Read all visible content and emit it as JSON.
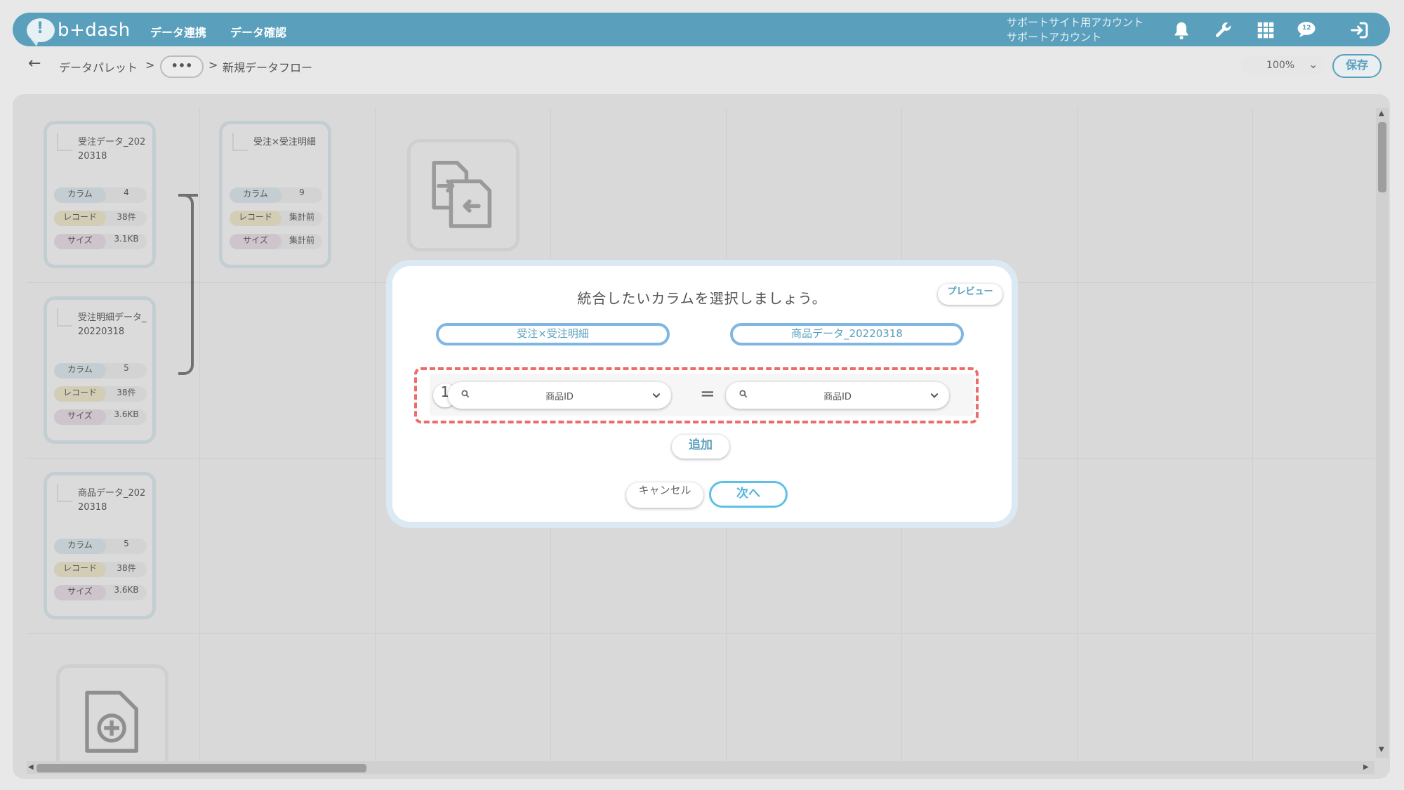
{
  "header": {
    "logo_text": "b+dash",
    "nav": [
      "データ連携",
      "データ確認"
    ],
    "account_line1": "サポートサイト用アカウント",
    "account_line2": "サポートアカウント",
    "icons": [
      "bell-icon",
      "wrench-icon",
      "apps-grid-icon",
      "chat-bubble-icon",
      "logout-icon"
    ],
    "chat_badge": "12",
    "color": "#5aa0bd"
  },
  "breadcrumb": {
    "root": "データパレット",
    "sep": ">",
    "more": "•••",
    "current": "新規データフロー"
  },
  "toolbar": {
    "zoom": "100%",
    "save_label": "保存"
  },
  "nodes": [
    {
      "title": "受注データ_20220318",
      "rows": [
        {
          "k": "カラム",
          "v": "4"
        },
        {
          "k": "レコード",
          "v": "38件"
        },
        {
          "k": "サイズ",
          "v": "3.1KB"
        }
      ]
    },
    {
      "title": "受注明細データ_20220318",
      "rows": [
        {
          "k": "カラム",
          "v": "5"
        },
        {
          "k": "レコード",
          "v": "38件"
        },
        {
          "k": "サイズ",
          "v": "3.6KB"
        }
      ]
    },
    {
      "title": "商品データ_20220318",
      "rows": [
        {
          "k": "カラム",
          "v": "5"
        },
        {
          "k": "レコード",
          "v": "38件"
        },
        {
          "k": "サイズ",
          "v": "3.6KB"
        }
      ]
    },
    {
      "title": "受注×受注明細",
      "rows": [
        {
          "k": "カラム",
          "v": "9"
        },
        {
          "k": "レコード",
          "v": "集計前"
        },
        {
          "k": "サイズ",
          "v": "集計前"
        }
      ]
    }
  ],
  "modal": {
    "title": "統合したいカラムを選択しましょう。",
    "preview_label": "プレビュー",
    "left_table": "受注×受注明細",
    "right_table": "商品データ_20220318",
    "condition_number": "1",
    "left_column": "商品ID",
    "right_column": "商品ID",
    "operator": "=",
    "add_label": "追加",
    "cancel_label": "キャンセル",
    "next_label": "次へ",
    "accent": "#4fb5df",
    "highlight": "#ef6a6a"
  }
}
